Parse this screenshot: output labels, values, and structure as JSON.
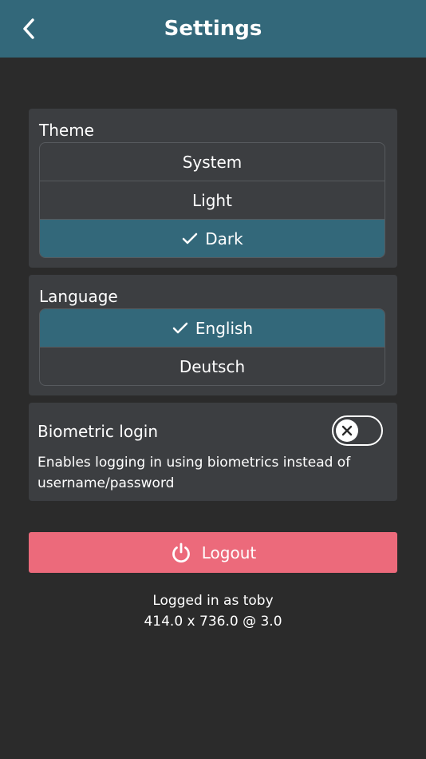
{
  "header": {
    "title": "Settings",
    "back_icon": "chevron-left-icon"
  },
  "theme": {
    "title": "Theme",
    "options": [
      "System",
      "Light",
      "Dark"
    ],
    "selected": "Dark"
  },
  "language": {
    "title": "Language",
    "options": [
      "English",
      "Deutsch"
    ],
    "selected": "English"
  },
  "biometric": {
    "title": "Biometric login",
    "description": "Enables logging in using biometrics instead of username/password",
    "enabled": false
  },
  "logout": {
    "label": "Logout",
    "icon": "power-icon"
  },
  "footer": {
    "logged_in": "Logged in as toby",
    "screen_info": "414.0 x 736.0 @ 3.0"
  },
  "colors": {
    "header": "#33687a",
    "background": "#2b2b2b",
    "card": "#3c3e41",
    "selected": "#33687a",
    "logout": "#ec6a7b"
  }
}
